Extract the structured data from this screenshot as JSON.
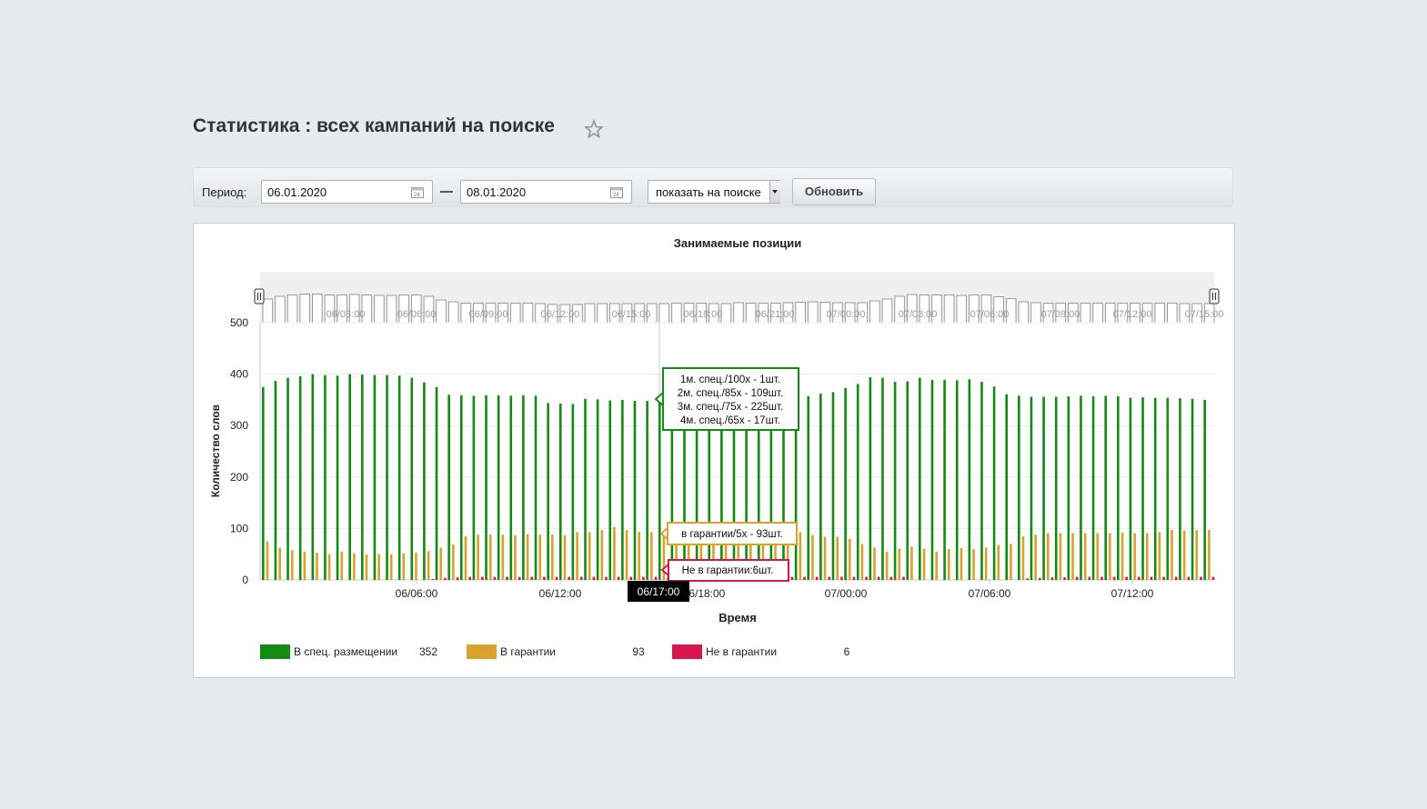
{
  "page": {
    "title": "Статистика : всех кампаний на поиске"
  },
  "filters": {
    "period_label": "Период:",
    "date_from": "06.01.2020",
    "date_to": "08.01.2020",
    "mode_value": "показать на поиске",
    "update_button": "Обновить"
  },
  "chart_data": {
    "type": "bar",
    "title": "Занимаемые позиции",
    "xlabel": "Время",
    "ylabel": "Количество слов",
    "ylim": [
      0,
      500
    ],
    "y_ticks": [
      0,
      100,
      200,
      300,
      400,
      500
    ],
    "x_tick_labels": [
      "06/06:00",
      "06/12:00",
      "06/18:00",
      "07/00:00",
      "07/06:00",
      "07/12:00"
    ],
    "navigator_labels": [
      "06/03:00",
      "06/06:00",
      "06/09:00",
      "06/12:00",
      "06/15:00",
      "06/18:00",
      "06/21:00",
      "07/00:00",
      "07/03:00",
      "07/06:00",
      "07/09:00",
      "07/12:00",
      "07/15:00"
    ],
    "colors": {
      "spec": "#138a13",
      "guarantee": "#d9a22a",
      "noguarantee": "#d8154f"
    },
    "series": [
      {
        "name": "В спец. размещении",
        "values": [
          375,
          387,
          393,
          396,
          400,
          398,
          397,
          400,
          399,
          398,
          398,
          397,
          393,
          384,
          375,
          360,
          359,
          358,
          359,
          359,
          358,
          359,
          358,
          344,
          343,
          342,
          352,
          351,
          349,
          350,
          348,
          348,
          350,
          350,
          350,
          351,
          350,
          350,
          352,
          352,
          352,
          352,
          350,
          350,
          357,
          362,
          365,
          373,
          381,
          394,
          393,
          385,
          386,
          393,
          389,
          389,
          388,
          390,
          385,
          376,
          361,
          358,
          356,
          356,
          356,
          357,
          358,
          357,
          358,
          357,
          354,
          355,
          354,
          354,
          353,
          352,
          350
        ]
      },
      {
        "name": "В гарантии",
        "values": [
          75,
          63,
          58,
          55,
          53,
          50,
          55,
          52,
          50,
          50,
          50,
          52,
          53,
          56,
          63,
          69,
          85,
          88,
          88,
          88,
          87,
          89,
          88,
          88,
          87,
          93,
          93,
          97,
          103,
          97,
          93,
          93,
          93,
          93,
          93,
          93,
          93,
          93,
          93,
          93,
          93,
          93,
          93,
          93,
          87,
          84,
          84,
          80,
          70,
          63,
          55,
          61,
          65,
          61,
          55,
          60,
          62,
          60,
          63,
          68,
          70,
          85,
          88,
          91,
          91,
          91,
          91,
          91,
          91,
          92,
          91,
          91,
          93,
          97,
          96,
          97,
          97
        ]
      },
      {
        "name": "Не в гарантии",
        "values": [
          0,
          0,
          0,
          0,
          0,
          0,
          0,
          0,
          0,
          0,
          0,
          0,
          0,
          2,
          4,
          5,
          6,
          6,
          6,
          6,
          6,
          6,
          6,
          6,
          6,
          6,
          6,
          6,
          6,
          6,
          6,
          6,
          6,
          6,
          6,
          6,
          6,
          6,
          6,
          6,
          6,
          6,
          6,
          6,
          6,
          6,
          6,
          6,
          6,
          6,
          6,
          6,
          0,
          0,
          0,
          0,
          0,
          0,
          0,
          0,
          0,
          3,
          4,
          5,
          5,
          6,
          6,
          6,
          6,
          6,
          6,
          6,
          6,
          6,
          6,
          6,
          6
        ]
      }
    ],
    "legend": [
      {
        "name": "В спец. размещении",
        "value": "352"
      },
      {
        "name": "В гарантии",
        "value": "93"
      },
      {
        "name": "Не в гарантии",
        "value": "6"
      }
    ],
    "tooltip_spec": [
      "1м. спец./100х - 1шт.",
      "2м. спец./85х - 109шт.",
      "3м. спец./75х - 225шт.",
      "4м. спец./65х - 17шт."
    ],
    "tooltip_guarantee": "в гарантии/5х - 93шт.",
    "tooltip_noguarantee": "Не в гарантии:6шт.",
    "crosshair_label": "06/17:00",
    "navigator_values": [
      52,
      58,
      61,
      63,
      63,
      61,
      61,
      62,
      61,
      60,
      60,
      61,
      61,
      58,
      50,
      46,
      43,
      43,
      43,
      43,
      43,
      43,
      42,
      40,
      40,
      40,
      42,
      42,
      42,
      42,
      42,
      42,
      42,
      43,
      43,
      43,
      42,
      42,
      44,
      43,
      43,
      43,
      44,
      45,
      46,
      45,
      44,
      44,
      44,
      48,
      52,
      58,
      62,
      61,
      61,
      61,
      60,
      61,
      61,
      57,
      53,
      46,
      44,
      43,
      43,
      43,
      43,
      43,
      43,
      43,
      43,
      43,
      43,
      43,
      42,
      42,
      42
    ]
  }
}
